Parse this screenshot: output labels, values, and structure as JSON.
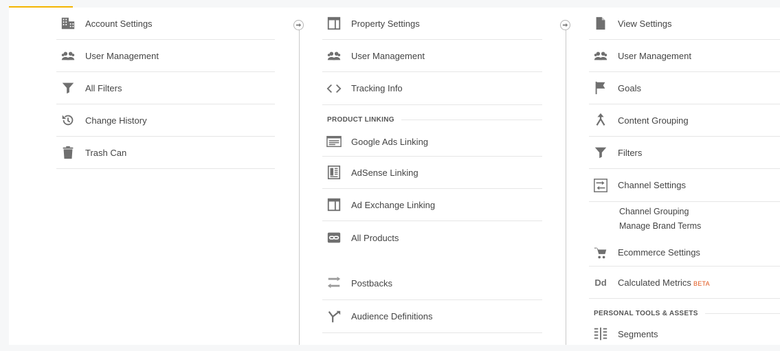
{
  "account": {
    "items": [
      {
        "label": "Account Settings",
        "icon": "building-icon"
      },
      {
        "label": "User Management",
        "icon": "people-icon"
      },
      {
        "label": "All Filters",
        "icon": "filter-icon"
      },
      {
        "label": "Change History",
        "icon": "history-icon"
      },
      {
        "label": "Trash Can",
        "icon": "trash-icon"
      }
    ]
  },
  "property": {
    "items": [
      {
        "label": "Property Settings",
        "icon": "property-icon"
      },
      {
        "label": "User Management",
        "icon": "people-icon"
      },
      {
        "label": "Tracking Info",
        "icon": "code-icon"
      }
    ],
    "product_linking_heading": "PRODUCT LINKING",
    "linking_items": [
      {
        "label": "Google Ads Linking",
        "icon": "google-ads-icon"
      },
      {
        "label": "AdSense Linking",
        "icon": "adsense-icon"
      },
      {
        "label": "Ad Exchange Linking",
        "icon": "ad-exchange-icon"
      },
      {
        "label": "All Products",
        "icon": "link-icon"
      }
    ],
    "other_items": [
      {
        "label": "Postbacks",
        "icon": "postbacks-icon"
      },
      {
        "label": "Audience Definitions",
        "icon": "audience-icon"
      }
    ]
  },
  "view": {
    "items": [
      {
        "label": "View Settings",
        "icon": "document-icon"
      },
      {
        "label": "User Management",
        "icon": "people-icon"
      },
      {
        "label": "Goals",
        "icon": "flag-icon"
      },
      {
        "label": "Content Grouping",
        "icon": "merge-icon"
      },
      {
        "label": "Filters",
        "icon": "filter-icon"
      },
      {
        "label": "Channel Settings",
        "icon": "channel-icon"
      }
    ],
    "channel_subitems": [
      "Channel Grouping",
      "Manage Brand Terms"
    ],
    "ecommerce_label": "Ecommerce Settings",
    "calculated_metrics_label": "Calculated Metrics",
    "calculated_metrics_badge": "BETA",
    "calculated_metrics_icon_text": "Dd",
    "personal_heading": "PERSONAL TOOLS & ASSETS",
    "segments_label": "Segments"
  },
  "colors": {
    "accent": "#f4b400",
    "beta": "#e0561b",
    "icon": "#6f6f6f"
  }
}
